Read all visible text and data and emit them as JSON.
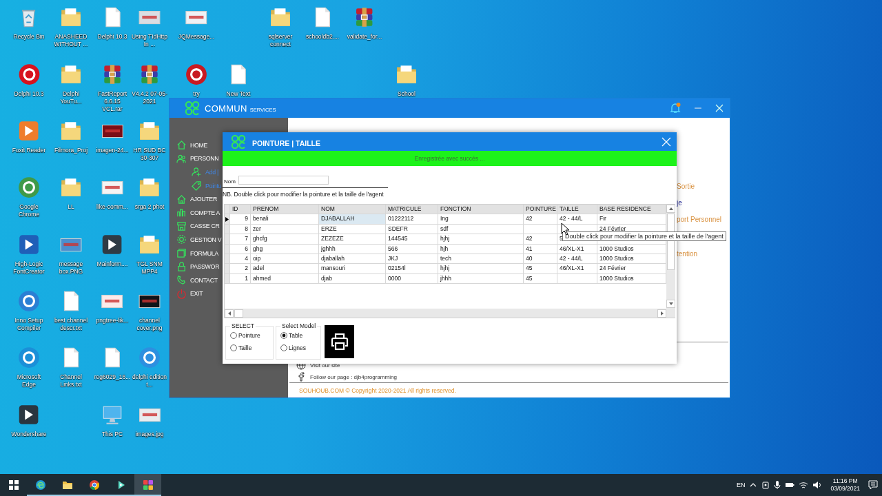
{
  "desktop": {
    "icons": [
      {
        "label": "Recycle Bin",
        "kind": "recycle"
      },
      {
        "label": "ANASHEED WITHOUT ...",
        "kind": "folder"
      },
      {
        "label": "Delphi 10.3",
        "kind": "file"
      },
      {
        "label": "Using TIdHttp In ...",
        "kind": "image",
        "color": "#d9dde3"
      },
      {
        "label": "JQMessage...",
        "kind": "image",
        "color": "#eef1f5"
      },
      {
        "label": "sqlserver connect",
        "kind": "folder"
      },
      {
        "label": "schooldb2....",
        "kind": "file"
      },
      {
        "label": "validate_for...",
        "kind": "archive"
      },
      {
        "label": "Delphi 10.3",
        "kind": "logo",
        "color": "#d7131f"
      },
      {
        "label": "Delphi YouTu...",
        "kind": "folder"
      },
      {
        "label": "FastReport 6.6.15 VCL.rar",
        "kind": "archive"
      },
      {
        "label": "V4.4.2 07-05-2021",
        "kind": "archive"
      },
      {
        "label": "try",
        "kind": "logo",
        "color": "#c81a22"
      },
      {
        "label": "New Text",
        "kind": "file"
      },
      {
        "label": "School",
        "kind": "folder"
      },
      {
        "label": "Foxit Reader",
        "kind": "app",
        "color": "#ef7d2c"
      },
      {
        "label": "Filmora_Proj",
        "kind": "folder"
      },
      {
        "label": "imagen-24...",
        "kind": "image",
        "color": "#7a0d16"
      },
      {
        "label": "HR SUD BC 30-307",
        "kind": "folder"
      },
      {
        "label": "Google Chrome",
        "kind": "logo",
        "color": "#3f9a48"
      },
      {
        "label": "LL",
        "kind": "folder"
      },
      {
        "label": "like-comm...",
        "kind": "image",
        "color": "#f4f4f4"
      },
      {
        "label": "srga 2 phot",
        "kind": "folder"
      },
      {
        "label": "High-Logic FontCreator",
        "kind": "app",
        "color": "#1f5fb8"
      },
      {
        "label": "message box.PNG",
        "kind": "image",
        "color": "#4b8fcf"
      },
      {
        "label": "Mainform....",
        "kind": "app",
        "color": "#2f3b45"
      },
      {
        "label": "TGL SNM MPP4",
        "kind": "folder"
      },
      {
        "label": "Inno Setup Compiler",
        "kind": "logo",
        "color": "#2a7fd4"
      },
      {
        "label": "best channel descr.txt",
        "kind": "file"
      },
      {
        "label": "pngtree-lik...",
        "kind": "image",
        "color": "#fbeaea"
      },
      {
        "label": "channel cover.png",
        "kind": "image",
        "color": "#101418"
      },
      {
        "label": "Microsoft Edge",
        "kind": "logo",
        "color": "#1b8fd8"
      },
      {
        "label": "Channel Links.txt",
        "kind": "file"
      },
      {
        "label": "reg6029_16...",
        "kind": "file"
      },
      {
        "label": "delphi edition t...",
        "kind": "logo",
        "color": "#2d8fe0"
      },
      {
        "label": "Wondershare",
        "kind": "app",
        "color": "#2a3640"
      },
      {
        "label": "This PC",
        "kind": "pc"
      },
      {
        "label": "images.jpg",
        "kind": "image",
        "color": "#e9ecef"
      }
    ]
  },
  "main_window": {
    "title": "COMMUN",
    "subtitle": "SERVICES",
    "notification": true,
    "sidebar": [
      {
        "label": "HOME",
        "kind": "main"
      },
      {
        "label": "PERSONN",
        "kind": "main"
      },
      {
        "label": "Add |",
        "kind": "sub"
      },
      {
        "label": "Pointu",
        "kind": "sub"
      },
      {
        "label": "AJOUTER",
        "kind": "main"
      },
      {
        "label": "COMPTE A",
        "kind": "main"
      },
      {
        "label": "CASSE CR",
        "kind": "main"
      },
      {
        "label": "GESTION V",
        "kind": "main"
      },
      {
        "label": "FORMULA",
        "kind": "main"
      },
      {
        "label": "PASSWOR",
        "kind": "main"
      },
      {
        "label": "CONTACT",
        "kind": "main"
      },
      {
        "label": "EXIT",
        "kind": "exit"
      }
    ],
    "links": [
      {
        "text": "Sortie",
        "kind": "link"
      },
      {
        "text": "je",
        "kind": "heading"
      },
      {
        "text": "port Personnel",
        "kind": "link"
      },
      {
        "text": "tention",
        "kind": "link"
      }
    ],
    "visit": "Visit our site",
    "follow": "Follow our page : djb4programming",
    "copyright": "SOUHOUB.COM © Copyright 2020-2021 All rights reserved."
  },
  "dialog": {
    "title": "POINTURE | TAILLE",
    "message": "Enregistrée avec succés ...",
    "nom_label": "Nom",
    "note": "NB. Double click pour modifier la pointure et la taille  de l'agent",
    "columns": [
      "ID",
      "PRENOM",
      "NOM",
      "MATRICULE",
      "FONCTION",
      "POINTURE",
      "TAILLE",
      "BASE RESIDENCE"
    ],
    "rows": [
      {
        "selected": true,
        "id": "9",
        "prenom": "benali",
        "nom": "DJABALLAH",
        "matricule": "01222112",
        "fonction": "Ing",
        "pointure": "42",
        "taille": "42 - 44/L",
        "base_residence": "Fir"
      },
      {
        "selected": false,
        "id": "8",
        "prenom": "zer",
        "nom": "ERZE",
        "matricule": "SDEFR",
        "fonction": "sdf",
        "base_residence": "24 Février"
      },
      {
        "selected": false,
        "id": "7",
        "prenom": "ghcfg",
        "nom": "ZEZEZE",
        "matricule": "144545",
        "fonction": "hjhj",
        "pointure": "42",
        "taille": "5"
      },
      {
        "selected": false,
        "id": "6",
        "prenom": "ghg",
        "nom": "jghhh",
        "matricule": "566",
        "fonction": "hjh",
        "pointure": "41",
        "taille": "46/XL-X1",
        "base_residence": "1000 Studios"
      },
      {
        "selected": false,
        "id": "4",
        "prenom": "oip",
        "nom": "djaballah",
        "matricule": "JKJ",
        "fonction": "tech",
        "pointure": "40",
        "taille": "42 - 44/L",
        "base_residence": "1000 Studios"
      },
      {
        "selected": false,
        "id": "2",
        "prenom": "adel",
        "nom": "mansouri",
        "matricule": "02154l",
        "fonction": "hjhj",
        "pointure": "45",
        "taille": "46/XL-X1",
        "base_residence": "24 Février"
      },
      {
        "selected": false,
        "id": "1",
        "prenom": "ahmed",
        "nom": "djab",
        "matricule": "0000",
        "fonction": "jhhh",
        "pointure": "45",
        "base_residence": "1000 Studios"
      }
    ],
    "select": {
      "legend": "SELECT",
      "options": [
        {
          "label": "Pointure",
          "selected": false
        },
        {
          "label": "Taille",
          "selected": false
        }
      ]
    },
    "model": {
      "legend": "Select Model",
      "options": [
        {
          "label": "Table",
          "selected": true
        },
        {
          "label": "Lignes",
          "selected": false
        }
      ]
    }
  },
  "tooltip": "Double click pour modifier la pointure et la taille  de l'agent",
  "taskbar": {
    "apps": [
      {
        "kind": "start",
        "running": false,
        "active": false
      },
      {
        "kind": "edge",
        "running": true,
        "active": false
      },
      {
        "kind": "explorer",
        "running": true,
        "active": false
      },
      {
        "kind": "chrome",
        "running": true,
        "active": false
      },
      {
        "kind": "filmora",
        "running": true,
        "active": false
      },
      {
        "kind": "grid",
        "running": true,
        "active": true
      }
    ],
    "language": "EN",
    "time": "11:16 PM",
    "date": "03/09/2021"
  }
}
